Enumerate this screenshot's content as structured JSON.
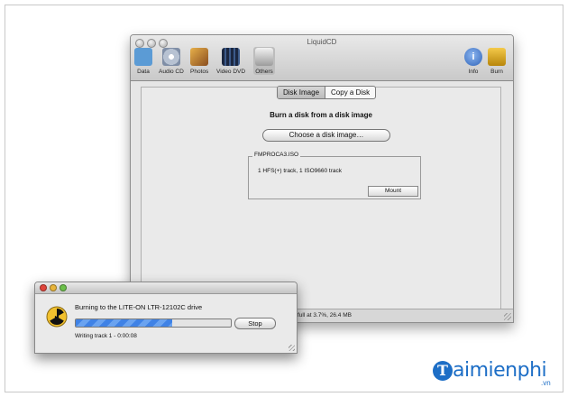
{
  "main_window": {
    "title": "LiquidCD",
    "toolbar": [
      {
        "label": "Data",
        "icon": "data-folder-icon",
        "color": "#5b9bd5"
      },
      {
        "label": "Audio CD",
        "icon": "audio-cd-icon",
        "color": "#9aa7b8"
      },
      {
        "label": "Photos",
        "icon": "photos-icon",
        "color": "#c97a2c"
      },
      {
        "label": "Video DVD",
        "icon": "video-dvd-icon",
        "color": "#2a3b5a"
      },
      {
        "label": "Others",
        "icon": "others-icon",
        "color": "#8a8a8a"
      }
    ],
    "toolbar_right": [
      {
        "label": "Info",
        "icon": "info-icon",
        "color": "#4b85d6"
      },
      {
        "label": "Burn",
        "icon": "burn-icon",
        "color": "#d8a41f"
      }
    ],
    "tabs": [
      "Disk Image",
      "Copy a Disk"
    ],
    "heading": "Burn a disk from a disk image",
    "choose_button": "Choose a disk image…",
    "image_box": {
      "legend": "FMPROCA3.ISO",
      "info": "1 HFS(+) track, 1 ISO9660 track",
      "mount_button": "Mount"
    },
    "status_text": "full at 3.7%, 26.4 MB"
  },
  "burn_dialog": {
    "message": "Burning to the LITE-ON LTR-12102C drive",
    "progress": 0.62,
    "stop_button": "Stop",
    "sub_status": "Writing track 1 - 0:00:08"
  },
  "watermark": {
    "mark": "T",
    "text": "aimienphi",
    "suffix": ".vn"
  }
}
